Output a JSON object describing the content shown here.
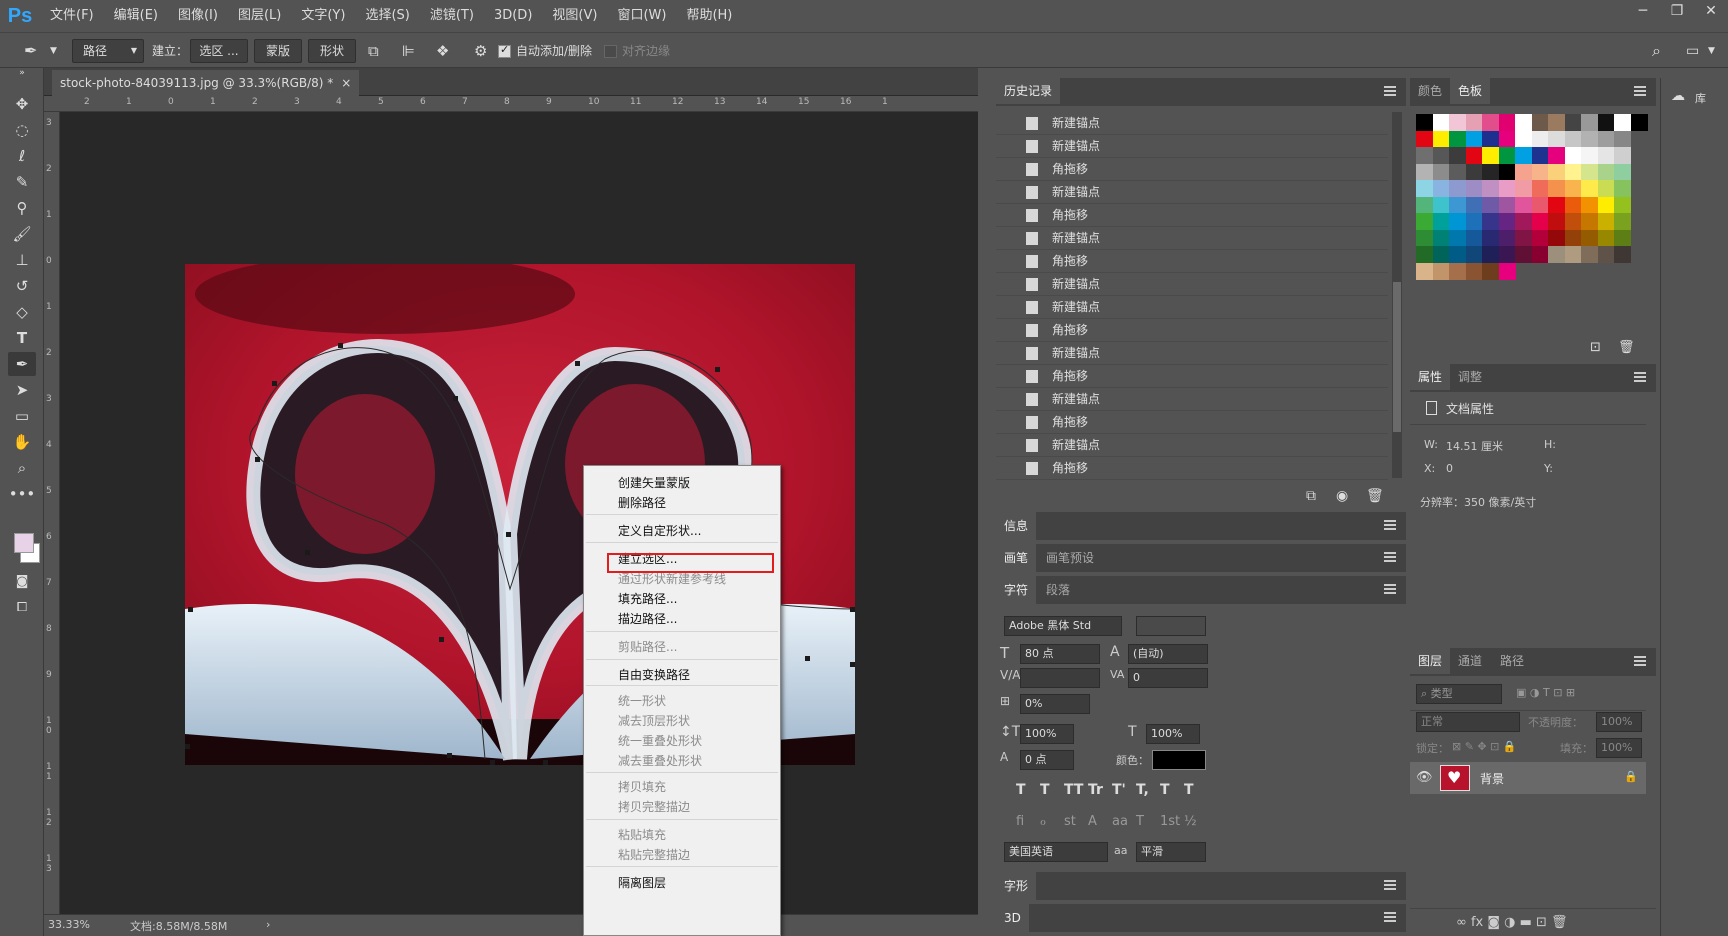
{
  "app": {
    "logo": "Ps"
  },
  "menubar": {
    "items": [
      "文件(F)",
      "编辑(E)",
      "图像(I)",
      "图层(L)",
      "文字(Y)",
      "选择(S)",
      "滤镜(T)",
      "3D(D)",
      "视图(V)",
      "窗口(W)",
      "帮助(H)"
    ]
  },
  "window_controls": {
    "minimize": "─",
    "restore": "❐",
    "close": "✕"
  },
  "options": {
    "mode": "路径",
    "make_label": "建立：",
    "selection_btn": "选区 ...",
    "mask_btn": "蒙版",
    "shape_btn": "形状",
    "auto_add_delete": "自动添加/删除",
    "align_edges": "对齐边缘"
  },
  "document": {
    "tab_title": "stock-photo-84039113.jpg @ 33.3%(RGB/8) *",
    "zoom": "33.33%",
    "doc_info": "文档:8.58M/8.58M"
  },
  "rulers": {
    "h": [
      "2",
      "1",
      "0",
      "1",
      "2",
      "3",
      "4",
      "5",
      "6",
      "7",
      "8",
      "9",
      "10",
      "11",
      "12",
      "13",
      "14",
      "15",
      "16",
      "1"
    ],
    "v": [
      "3",
      "2",
      "1",
      "0",
      "1",
      "2",
      "3",
      "4",
      "5",
      "6",
      "7",
      "8",
      "9",
      "1 0",
      "1 1",
      "1 2",
      "1 3"
    ]
  },
  "context_menu": {
    "items": [
      {
        "label": "创建矢量蒙版",
        "enabled": true
      },
      {
        "label": "删除路径",
        "enabled": true
      },
      {
        "label": "定义自定形状...",
        "enabled": true
      },
      {
        "label": "建立选区...",
        "enabled": true
      },
      {
        "label": "通过形状新建参考线",
        "enabled": false
      },
      {
        "label": "填充路径...",
        "enabled": true
      },
      {
        "label": "描边路径...",
        "enabled": true
      },
      {
        "label": "剪贴路径...",
        "enabled": false
      },
      {
        "label": "自由变换路径",
        "enabled": true
      },
      {
        "label": "统一形状",
        "enabled": false
      },
      {
        "label": "减去顶层形状",
        "enabled": false
      },
      {
        "label": "统一重叠处形状",
        "enabled": false
      },
      {
        "label": "减去重叠处形状",
        "enabled": false
      },
      {
        "label": "拷贝填充",
        "enabled": false
      },
      {
        "label": "拷贝完整描边",
        "enabled": false
      },
      {
        "label": "粘贴填充",
        "enabled": false
      },
      {
        "label": "粘贴完整描边",
        "enabled": false
      },
      {
        "label": "隔离图层",
        "enabled": true
      }
    ]
  },
  "history": {
    "title": "历史记录",
    "items": [
      "新建锚点",
      "新建锚点",
      "角拖移",
      "新建锚点",
      "角拖移",
      "新建锚点",
      "角拖移",
      "新建锚点",
      "新建锚点",
      "角拖移",
      "新建锚点",
      "角拖移",
      "新建锚点",
      "角拖移",
      "新建锚点",
      "角拖移"
    ]
  },
  "info_panel": {
    "title": "信息"
  },
  "brush_panel": {
    "tabs": [
      "画笔",
      "画笔预设"
    ]
  },
  "character_panel": {
    "tabs": [
      "字符",
      "段落"
    ],
    "font_family": "Adobe 黑体 Std",
    "font_size": "80 点",
    "leading": "(自动)",
    "tracking": "0",
    "scale_pct": "0%",
    "vertical_scale": "100%",
    "horizontal_scale": "100%",
    "baseline": "0 点",
    "color_label": "颜色：",
    "language": "美国英语",
    "aa_label": "a",
    "antialias": "平滑",
    "style_buttons": [
      "T",
      "T",
      "TT",
      "Tr",
      "T'",
      "T,",
      "T",
      "T"
    ],
    "opentype_buttons": [
      "fi",
      "ℴ",
      "st",
      "A",
      "aa",
      "T",
      "1st",
      "½"
    ]
  },
  "glyphs_panel": {
    "title": "字形"
  },
  "threed_panel": {
    "title": "3D"
  },
  "color_panel": {
    "tabs": [
      "颜色",
      "色板"
    ]
  },
  "properties_panel": {
    "tabs": [
      "属性",
      "调整"
    ],
    "header": "文档属性",
    "w_label": "W:",
    "w_value": "14.51 厘米",
    "h_label": "H:",
    "x_label": "X:",
    "x_value": "0",
    "y_label": "Y:",
    "resolution": "分辨率：350 像素/英寸"
  },
  "layers_panel": {
    "tabs": [
      "图层",
      "通道",
      "路径"
    ],
    "filter_label": "类型",
    "blend_mode": "正常",
    "opacity_label": "不透明度：",
    "opacity": "100%",
    "lock_label": "锁定：",
    "fill_label": "填充：",
    "fill": "100%",
    "layer_name": "背景"
  },
  "libraries": {
    "label": "库"
  },
  "colors": {
    "accent_red": "#e21d1d",
    "photo_red": "#b8132c",
    "ps_blue": "#31a8ff"
  }
}
